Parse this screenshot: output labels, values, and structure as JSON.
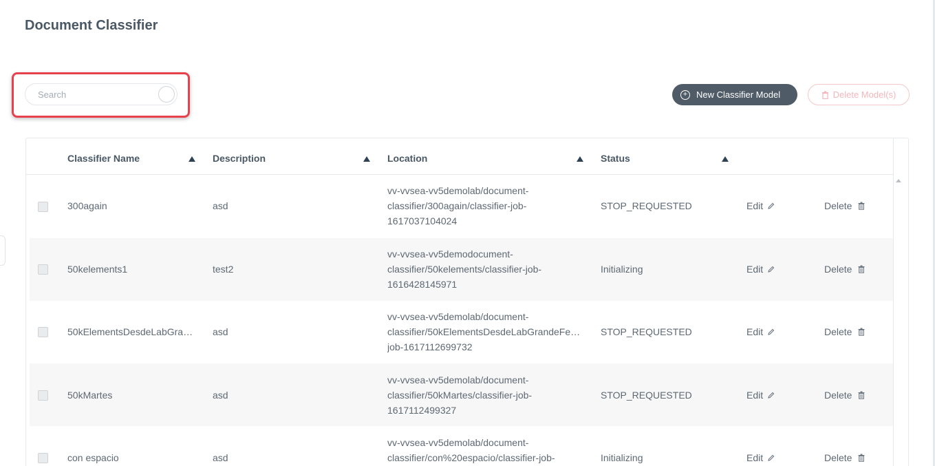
{
  "page": {
    "title": "Document Classifier"
  },
  "search": {
    "placeholder": "Search",
    "value": ""
  },
  "toolbar": {
    "new_label": "New Classifier Model",
    "delete_label": "Delete Model(s)"
  },
  "table": {
    "columns": [
      "Classifier Name",
      "Description",
      "Location",
      "Status"
    ],
    "rows": [
      {
        "name": "300again",
        "description": "asd",
        "location": [
          "vv-vvsea-vv5demolab/document-",
          "classifier/300again/classifier-job-",
          "1617037104024"
        ],
        "status": "STOP_REQUESTED",
        "edit": "Edit",
        "delete": "Delete"
      },
      {
        "name": "50kelements1",
        "description": "test2",
        "location": [
          "vv-vvsea-vv5demodocument-",
          "classifier/50kelements/classifier-job-",
          "1616428145971"
        ],
        "status": "Initializing",
        "edit": "Edit",
        "delete": "Delete"
      },
      {
        "name": "50kElementsDesdeLabGrandeFe…",
        "description": "asd",
        "location": [
          "vv-vvsea-vv5demolab/document-",
          "classifier/50kElementsDesdeLabGrandeFe…",
          "job-1617112699732"
        ],
        "status": "STOP_REQUESTED",
        "edit": "Edit",
        "delete": "Delete"
      },
      {
        "name": "50kMartes",
        "description": "asd",
        "location": [
          "vv-vvsea-vv5demolab/document-",
          "classifier/50kMartes/classifier-job-",
          "1617112499327"
        ],
        "status": "STOP_REQUESTED",
        "edit": "Edit",
        "delete": "Delete"
      },
      {
        "name": "con espacio",
        "description": "asd",
        "location": [
          "vv-vvsea-vv5demolab/document-",
          "classifier/con%20espacio/classifier-job-",
          ""
        ],
        "status": "Initializing",
        "edit": "Edit",
        "delete": "Delete"
      }
    ]
  },
  "colors": {
    "primary_button": "#4f5b67",
    "danger_outline": "#f4c7cb",
    "highlight": "#e8414e",
    "row_alt": "#f7f7f7"
  },
  "icons": [
    "search-toggle-icon",
    "plus-circle-icon",
    "trash-icon",
    "sort-asc-icon",
    "pencil-icon"
  ]
}
